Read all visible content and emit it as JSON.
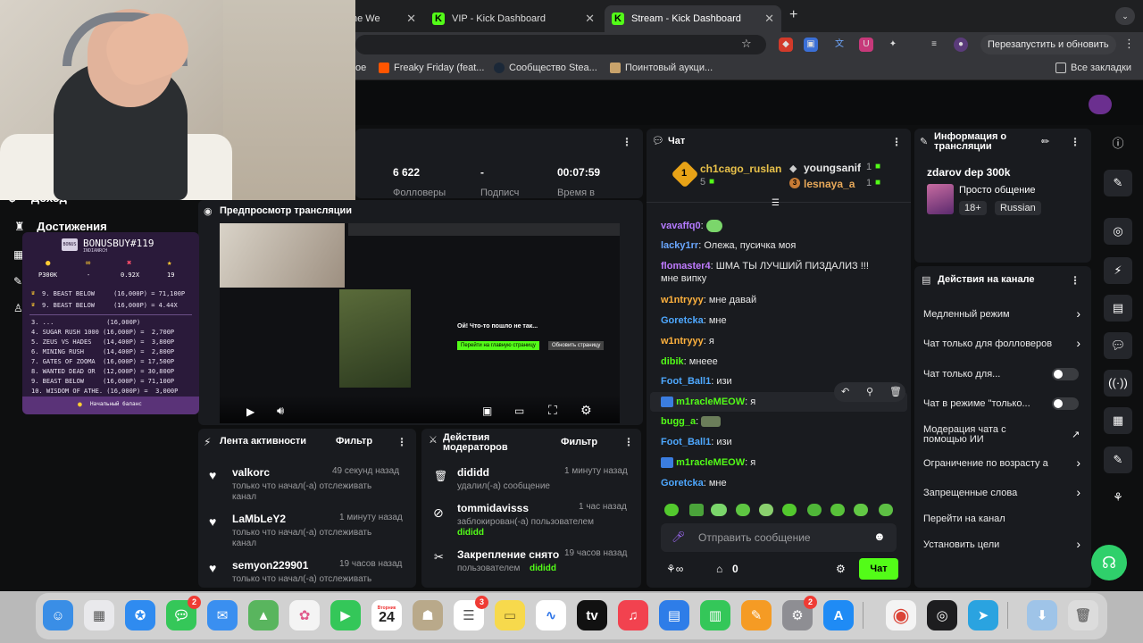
{
  "browser": {
    "tabs": [
      {
        "label": "ne We",
        "active": false
      },
      {
        "label": "VIP - Kick Dashboard",
        "active": false
      },
      {
        "label": "Stream - Kick Dashboard",
        "active": true
      }
    ],
    "new_tab": "+",
    "relaunch": "Перезапустить и обновить",
    "bookmarks": [
      "ое",
      "Freaky Friday (feat...",
      "Сообщество Stea...",
      "Поинтовый аукци..."
    ],
    "all_bookmarks": "Все закладки"
  },
  "stats": {
    "followers_value": "6 622",
    "followers_label": "Фолловеры",
    "subs_value": "-",
    "subs_label": "Подписч",
    "time_value": "00:07:59",
    "time_label": "Время в"
  },
  "left_nav": {
    "income": "Доход",
    "achievements": "Достижения"
  },
  "bonusbuy": {
    "title": "BONUSBUY#119",
    "subtitle": "INDIANRCH",
    "stats": [
      "Р300К",
      "-",
      "0.92X",
      "19"
    ],
    "top_rows": [
      "9. BEAST BELOW     (16,000Р) = 71,100Р",
      "9. BEAST BELOW     (16,000Р) = 4.44X"
    ],
    "rows": [
      "3. ...              (16,000Р)",
      "4. SUGAR RUSH 1000 (16,000Р) =  2,700Р",
      "5. ZEUS VS HADES   (14,400Р) =  3,800Р",
      "6. MINING RUSH     (14,400Р) =  2,800Р",
      "7. GATES OF ZOOMA  (16,000Р) = 17,500Р",
      "8. WANTED DEAD OR  (12,000Р) = 30,800Р",
      "9. BEAST BELOW     (16,000Р) = 71,100Р",
      "10. WISDOM OF ATHE. (16,000Р) =  3,000Р"
    ],
    "footer": "Начальный баланс"
  },
  "preview": {
    "title": "Предпросмотр трансляции",
    "error_title": "Ой! Что-то пошло не так...",
    "btn_home": "Перейти на главную страницу",
    "btn_refresh": "Обновить страницу"
  },
  "activity": {
    "title": "Лента активности",
    "filter": "Фильтр",
    "items": [
      {
        "user": "valkorc",
        "time": "49 секунд назад",
        "text1": "только что начал(-а) отслеживать",
        "text2": "канал"
      },
      {
        "user": "LaMbLeY2",
        "time": "1 минуту назад",
        "text1": "только что начал(-а) отслеживать",
        "text2": "канал"
      },
      {
        "user": "semyon229901",
        "time": "19 часов назад",
        "text1": "только что начал(-а) отслеживать",
        "text2": ""
      }
    ]
  },
  "modactions": {
    "title1": "Действия",
    "title2": "модераторов",
    "filter": "Фильтр",
    "items": [
      {
        "user": "dididd",
        "time": "1 минуту назад",
        "text": "удалил(-а) сообщение",
        "extra": ""
      },
      {
        "user": "tommidavisss",
        "time": "1 час назад",
        "text": "заблокирован(-а) пользователем",
        "extra": "dididd"
      },
      {
        "user": "Закрепление снято",
        "time": "19 часов назад",
        "text": "пользователем",
        "extra": "dididd"
      }
    ]
  },
  "chat": {
    "title": "Чат",
    "top": {
      "rank1_user": "ch1cago_ruslan",
      "rank1_count": "5",
      "badge1": "1",
      "user2": "youngsanif",
      "count2": "1",
      "user3": "lesnaya_a",
      "count3": "1",
      "badge3": "3"
    },
    "messages": [
      {
        "user": "vavaffq0",
        "text": "",
        "color": "#b57bff"
      },
      {
        "user": "lacky1rr",
        "text": "Олежа, пусичка моя",
        "color": "#6aa7ff"
      },
      {
        "user": "flomaster4",
        "text": "ШМА ТЫ ЛУЧШИЙ ПИЗДАЛИЗ !!!",
        "text2": "мне випку",
        "color": "#c07bff"
      },
      {
        "user": "w1ntryyy",
        "text": "мне давай",
        "color": "#ffb23e"
      },
      {
        "user": "Goretcka",
        "text": "мне",
        "color": "#4ea8ff"
      },
      {
        "user": "w1ntryyy",
        "text": "я",
        "color": "#ffb23e"
      },
      {
        "user": "dibik",
        "text": "мнеее",
        "color": "#53fc18"
      },
      {
        "user": "Foot_Ball1",
        "text": "изи",
        "color": "#4ea8ff"
      },
      {
        "user": "m1racleMEOW",
        "text": "я",
        "color": "#53fc18"
      },
      {
        "user": "bugg_a",
        "text": "",
        "color": "#53fc18"
      },
      {
        "user": "Foot_Ball1",
        "text": "изи",
        "color": "#4ea8ff"
      },
      {
        "user": "m1racleMEOW",
        "text": "я",
        "color": "#53fc18"
      },
      {
        "user": "Goretcka",
        "text": "мне",
        "color": "#4ea8ff"
      }
    ],
    "input_placeholder": "Отправить сообщение",
    "points": "0",
    "send": "Чат"
  },
  "info": {
    "title1": "Информация о",
    "title2": "трансляции",
    "stream_title": "zdarov dep 300k",
    "category": "Просто общение",
    "age": "18+",
    "lang": "Russian"
  },
  "channel_actions": {
    "title": "Действия на канале",
    "items": [
      {
        "label": "Медленный режим",
        "kind": "chevron"
      },
      {
        "label": "Чат только для фолловеров",
        "kind": "chevron"
      },
      {
        "label": "Чат только для...",
        "kind": "toggle"
      },
      {
        "label": "Чат в режиме \"только...",
        "kind": "toggle"
      },
      {
        "label": "Модерация чата с",
        "label2": "помощью ИИ",
        "kind": "external"
      },
      {
        "label": "Ограничение по возрасту а",
        "kind": "chevron"
      },
      {
        "label": "Запрещенные слова",
        "kind": "chevron"
      },
      {
        "label": "Перейти на канал",
        "kind": "none"
      },
      {
        "label": "Установить цели",
        "kind": "chevron"
      }
    ]
  },
  "dock": {
    "calendar_month": "Вторник",
    "calendar_day": "24",
    "badges": {
      "messages": "2",
      "reminders": "3",
      "settings": "2"
    }
  },
  "colors": {
    "kick_green": "#53fc18",
    "panel": "#191b1f",
    "bg": "#0e0f10"
  }
}
